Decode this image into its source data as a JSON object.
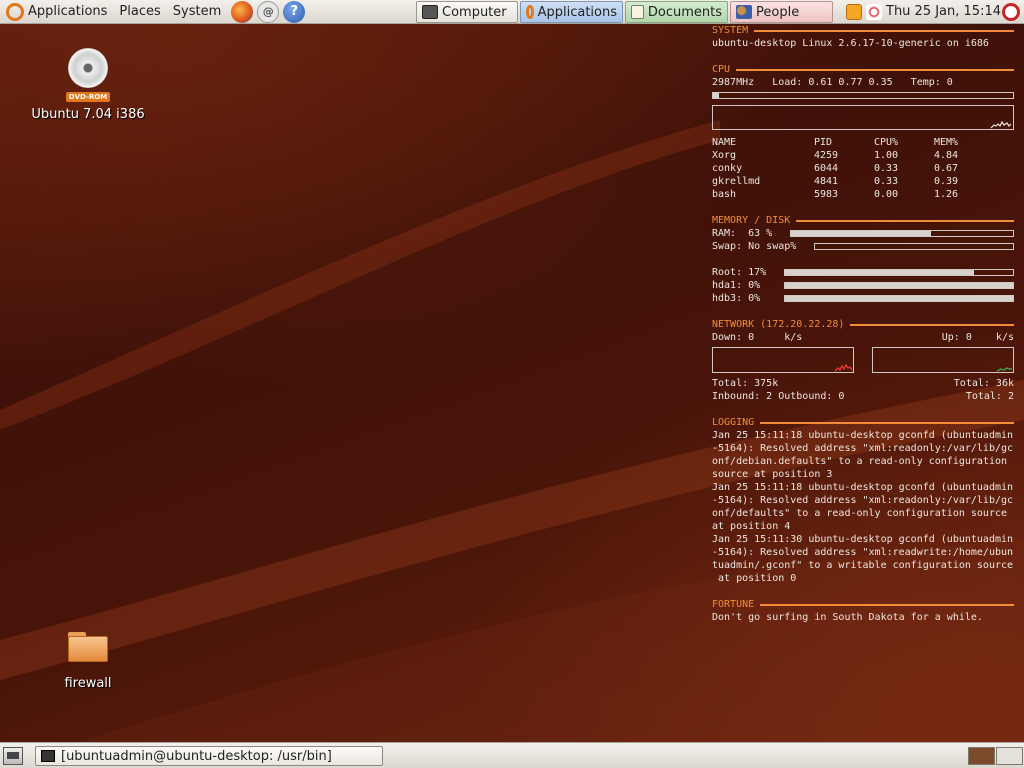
{
  "top_panel": {
    "menus": [
      "Applications",
      "Places",
      "System"
    ],
    "taskbar": [
      "Computer",
      "Applications",
      "Documents",
      "People"
    ],
    "clock": "Thu 25 Jan, 15:14"
  },
  "desktop": {
    "icons": [
      {
        "label": "Ubuntu 7.04 i386",
        "badge": "DVD-ROM"
      },
      {
        "label": "firewall"
      }
    ]
  },
  "conky": {
    "system": {
      "header": "SYSTEM",
      "info": "ubuntu-desktop Linux 2.6.17-10-generic on i686"
    },
    "cpu": {
      "header": "CPU",
      "line": "2987MHz   Load: 0.61 0.77 0.35   Temp: 0",
      "usage": 0.02,
      "columns": [
        "NAME",
        "PID",
        "CPU%",
        "MEM%"
      ],
      "processes": [
        [
          "Xorg",
          "4259",
          "1.00",
          "4.84"
        ],
        [
          "conky",
          "6044",
          "0.33",
          "0.67"
        ],
        [
          "gkrellmd",
          "4841",
          "0.33",
          "0.39"
        ],
        [
          "bash",
          "5983",
          "0.00",
          "1.26"
        ]
      ]
    },
    "memory": {
      "header": "MEMORY / DISK",
      "ram_label": "RAM:  ",
      "ram_value": "63 %",
      "ram_usage": 0.63,
      "swap_label": "Swap: ",
      "swap_value": "No swap%",
      "swap_usage": 0,
      "disks": [
        {
          "label": "Root: ",
          "value": "17%",
          "usage": 0.83
        },
        {
          "label": "hda1: ",
          "value": "0%",
          "usage": 1.0
        },
        {
          "label": "hdb3: ",
          "value": "0%",
          "usage": 1.0
        }
      ]
    },
    "network": {
      "header": "NETWORK (172.20.22.28)",
      "down_label": "Down: 0     k/s",
      "up_label": "Up: 0    k/s",
      "total_down": "Total: 375k",
      "total_up": "Total: 36k",
      "inbound": "Inbound: 2 Outbound: 0",
      "total_conn": "Total: 2"
    },
    "logging": {
      "header": "LOGGING",
      "text": "Jan 25 15:11:18 ubuntu-desktop gconfd (ubuntuadmin\n-5164): Resolved address \"xml:readonly:/var/lib/gc\nonf/debian.defaults\" to a read-only configuration\nsource at position 3\nJan 25 15:11:18 ubuntu-desktop gconfd (ubuntuadmin\n-5164): Resolved address \"xml:readonly:/var/lib/gc\nonf/defaults\" to a read-only configuration source\nat position 4\nJan 25 15:11:30 ubuntu-desktop gconfd (ubuntuadmin\n-5164): Resolved address \"xml:readwrite:/home/ubun\ntuadmin/.gconf\" to a writable configuration source\n at position 0"
    },
    "fortune": {
      "header": "FORTUNE",
      "text": "Don't go surfing in South Dakota for a while."
    }
  },
  "bottom_panel": {
    "task": "[ubuntuadmin@ubuntu-desktop: /usr/bin]"
  },
  "colors": {
    "accent": "#f28c3a",
    "ubuntu_orange": "#e0781b"
  }
}
